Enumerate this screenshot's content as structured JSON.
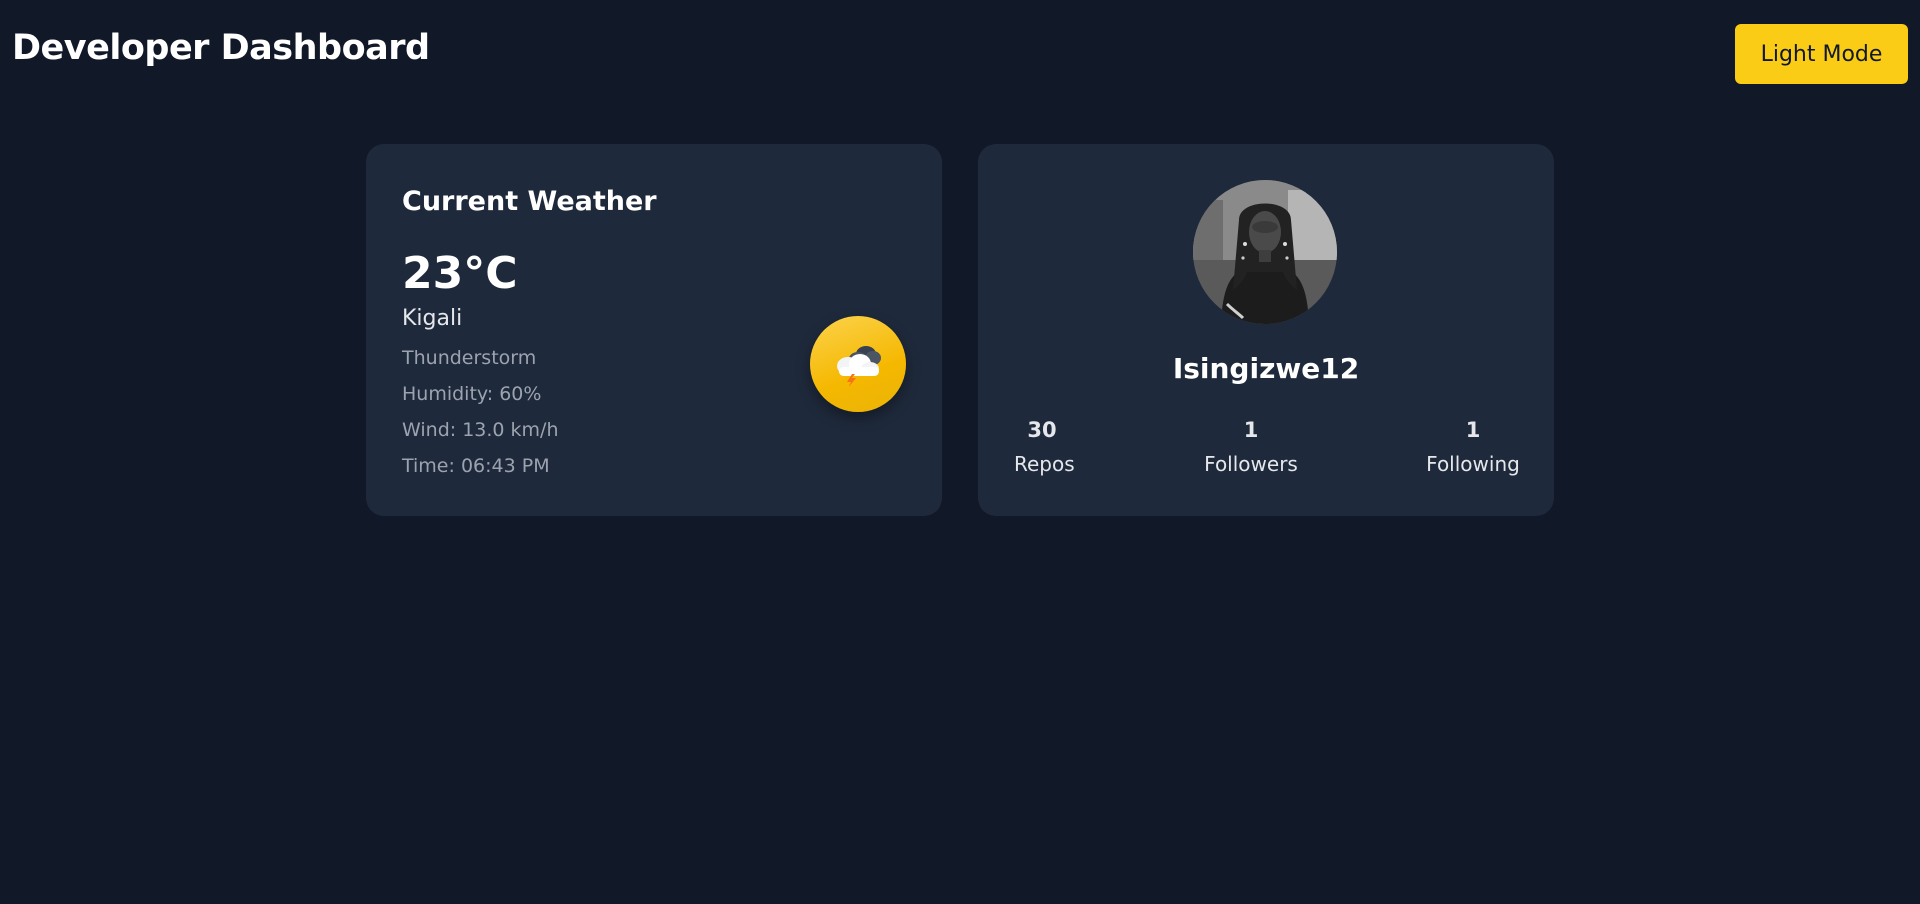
{
  "header": {
    "title": "Developer Dashboard",
    "theme_toggle_label": "Light Mode"
  },
  "weather": {
    "title": "Current Weather",
    "temperature": "23°C",
    "city": "Kigali",
    "condition": "Thunderstorm",
    "humidity": "Humidity: 60%",
    "wind": "Wind: 13.0 km/h",
    "time": "Time: 06:43 PM",
    "icon": "thunderstorm-icon"
  },
  "profile": {
    "username": "Isingizwe12",
    "stats": [
      {
        "value": "30",
        "label": "Repos"
      },
      {
        "value": "1",
        "label": "Followers"
      },
      {
        "value": "1",
        "label": "Following"
      }
    ]
  },
  "colors": {
    "background": "#111827",
    "card": "#1e293b",
    "accent": "#facc15"
  }
}
